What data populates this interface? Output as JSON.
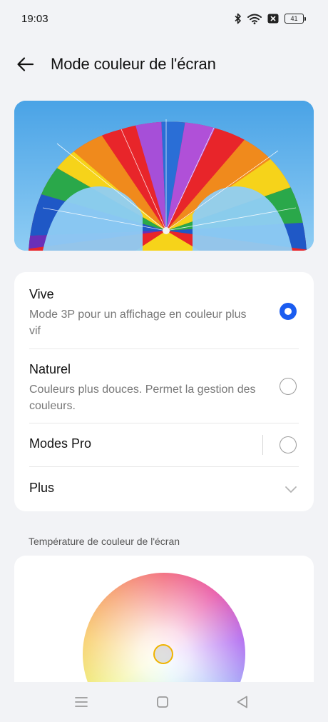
{
  "status_bar": {
    "time": "19:03",
    "battery": "41",
    "icons": [
      "bluetooth-icon",
      "wifi-icon",
      "sim-card-icon",
      "battery-icon"
    ]
  },
  "header": {
    "title": "Mode couleur de l'écran",
    "back_icon": "back-arrow-icon"
  },
  "options": [
    {
      "title": "Vive",
      "description": "Mode 3P pour un affichage en couleur plus vif",
      "selected": true
    },
    {
      "title": "Naturel",
      "description": "Couleurs plus douces. Permet la gestion des couleurs.",
      "selected": false
    },
    {
      "title": "Modes Pro",
      "selected": false
    },
    {
      "title": "Plus"
    }
  ],
  "temperature": {
    "label": "Température de couleur de l'écran"
  },
  "colors": {
    "accent": "#1a5cf0",
    "background": "#f2f3f6",
    "card": "#ffffff",
    "knob_border": "#f0b400"
  },
  "nav_bar": {
    "icons": [
      "menu-icon",
      "home-icon",
      "back-triangle-icon"
    ]
  }
}
